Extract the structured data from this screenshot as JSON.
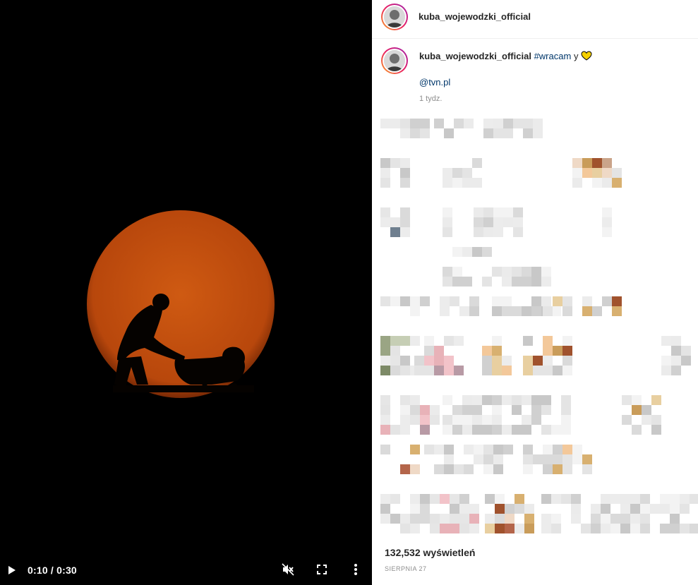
{
  "video": {
    "time": "0:10 / 0:30",
    "play_icon": "play-icon",
    "mute_icon": "muted-speaker-icon",
    "fullscreen_icon": "fullscreen-icon",
    "more_icon": "more-vertical-icon"
  },
  "post": {
    "username": "kuba_wojewodzki_official",
    "caption_user": "kuba_wojewodzki_official",
    "caption_hashtag": "#wracam",
    "caption_text": "y",
    "caption_emoji": "yellow-heart-icon",
    "mention": "@tvn.pl",
    "age": "1 tydz.",
    "views": "132,532 wyświetleń",
    "date": "SIERPNIA 27"
  },
  "colors": {
    "sun": "#c4500e",
    "link": "#00376b",
    "heart": "#f5d000"
  }
}
